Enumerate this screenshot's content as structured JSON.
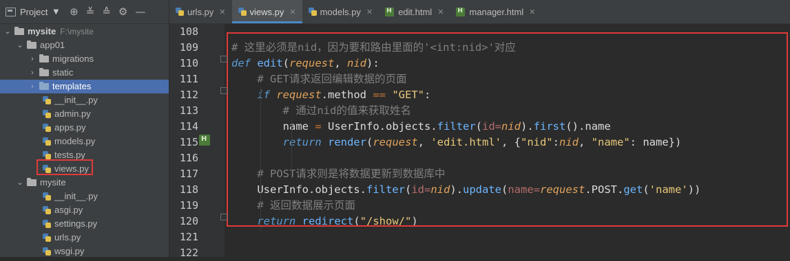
{
  "sidebar": {
    "toolbar": {
      "project_label": "Project"
    },
    "tree": [
      {
        "label": "mysite",
        "path": "F:\\mysite",
        "type": "folder-root",
        "expanded": true,
        "indent": 0
      },
      {
        "label": "app01",
        "type": "folder",
        "expanded": true,
        "indent": 1
      },
      {
        "label": "migrations",
        "type": "folder",
        "expanded": false,
        "indent": 2
      },
      {
        "label": "static",
        "type": "folder",
        "expanded": false,
        "indent": 2
      },
      {
        "label": "templates",
        "type": "folder",
        "expanded": false,
        "indent": 2,
        "selected": true
      },
      {
        "label": "__init__.py",
        "type": "py",
        "indent": 3
      },
      {
        "label": "admin.py",
        "type": "py",
        "indent": 3
      },
      {
        "label": "apps.py",
        "type": "py",
        "indent": 3
      },
      {
        "label": "models.py",
        "type": "py",
        "indent": 3
      },
      {
        "label": "tests.py",
        "type": "py",
        "indent": 3
      },
      {
        "label": "views.py",
        "type": "py",
        "indent": 3,
        "highlighted": true
      },
      {
        "label": "mysite",
        "type": "folder",
        "expanded": true,
        "indent": 1
      },
      {
        "label": "__init__.py",
        "type": "py",
        "indent": 3
      },
      {
        "label": "asgi.py",
        "type": "py",
        "indent": 3
      },
      {
        "label": "settings.py",
        "type": "py",
        "indent": 3
      },
      {
        "label": "urls.py",
        "type": "py",
        "indent": 3
      },
      {
        "label": "wsgi.py",
        "type": "py",
        "indent": 3
      }
    ]
  },
  "tabs": [
    {
      "label": "urls.py",
      "type": "py",
      "active": false
    },
    {
      "label": "views.py",
      "type": "py",
      "active": true
    },
    {
      "label": "models.py",
      "type": "py",
      "active": false
    },
    {
      "label": "edit.html",
      "type": "html",
      "active": false
    },
    {
      "label": "manager.html",
      "type": "html",
      "active": false
    }
  ],
  "editor": {
    "lines": [
      {
        "num": "108",
        "tokens": []
      },
      {
        "num": "109",
        "tokens": [
          [
            "cm",
            "# 这里必须是nid，因为要和路由里面的'<int:nid>'对应"
          ]
        ]
      },
      {
        "num": "110",
        "tokens": [
          [
            "kwi",
            "def "
          ],
          [
            "fn",
            "edit"
          ],
          [
            "tx",
            "("
          ],
          [
            "par",
            "request"
          ],
          [
            "tx",
            ", "
          ],
          [
            "par",
            "nid"
          ],
          [
            "tx",
            "):"
          ]
        ]
      },
      {
        "num": "111",
        "tokens": [
          [
            "tx",
            "    "
          ],
          [
            "cm",
            "# GET请求返回编辑数据的页面"
          ]
        ]
      },
      {
        "num": "112",
        "tokens": [
          [
            "tx",
            "    "
          ],
          [
            "kwi",
            "if "
          ],
          [
            "par",
            "request"
          ],
          [
            "tx",
            ".method "
          ],
          [
            "op",
            "=="
          ],
          [
            "tx",
            " "
          ],
          [
            "str",
            "\"GET\""
          ],
          [
            "tx",
            ":"
          ]
        ]
      },
      {
        "num": "113",
        "tokens": [
          [
            "tx",
            "        "
          ],
          [
            "cm",
            "# 通过nid的值来获取姓名"
          ]
        ]
      },
      {
        "num": "114",
        "tokens": [
          [
            "tx",
            "        name "
          ],
          [
            "op",
            "="
          ],
          [
            "tx",
            " UserInfo.objects."
          ],
          [
            "fn",
            "filter"
          ],
          [
            "tx",
            "("
          ],
          [
            "kwarg",
            "id="
          ],
          [
            "par",
            "nid"
          ],
          [
            "tx",
            ")."
          ],
          [
            "fn",
            "first"
          ],
          [
            "tx",
            "().name"
          ]
        ]
      },
      {
        "num": "115",
        "tokens": [
          [
            "tx",
            "        "
          ],
          [
            "kwi",
            "return "
          ],
          [
            "fn",
            "render"
          ],
          [
            "tx",
            "("
          ],
          [
            "par",
            "request"
          ],
          [
            "tx",
            ", "
          ],
          [
            "str",
            "'edit.html'"
          ],
          [
            "tx",
            ", {"
          ],
          [
            "str",
            "\"nid\""
          ],
          [
            "tx",
            ":"
          ],
          [
            "par",
            "nid"
          ],
          [
            "tx",
            ", "
          ],
          [
            "str",
            "\"name\""
          ],
          [
            "tx",
            ": name})"
          ]
        ]
      },
      {
        "num": "116",
        "tokens": []
      },
      {
        "num": "117",
        "tokens": [
          [
            "tx",
            "    "
          ],
          [
            "cm",
            "# POST请求则是将数据更新到数据库中"
          ]
        ]
      },
      {
        "num": "118",
        "tokens": [
          [
            "tx",
            "    UserInfo.objects."
          ],
          [
            "fn",
            "filter"
          ],
          [
            "tx",
            "("
          ],
          [
            "kwarg",
            "id="
          ],
          [
            "par",
            "nid"
          ],
          [
            "tx",
            ")."
          ],
          [
            "fn",
            "update"
          ],
          [
            "tx",
            "("
          ],
          [
            "kwarg",
            "name="
          ],
          [
            "par",
            "request"
          ],
          [
            "tx",
            ".POST."
          ],
          [
            "fn",
            "get"
          ],
          [
            "tx",
            "("
          ],
          [
            "str",
            "'name'"
          ],
          [
            "tx",
            "))"
          ]
        ]
      },
      {
        "num": "119",
        "tokens": [
          [
            "tx",
            "    "
          ],
          [
            "cm",
            "# 返回数据展示页面"
          ]
        ]
      },
      {
        "num": "120",
        "tokens": [
          [
            "tx",
            "    "
          ],
          [
            "kwi",
            "return "
          ],
          [
            "fn",
            "redirect"
          ],
          [
            "tx",
            "("
          ],
          [
            "str",
            "\"/show/\""
          ],
          [
            "tx",
            ")"
          ]
        ]
      },
      {
        "num": "121",
        "tokens": []
      },
      {
        "num": "122",
        "tokens": []
      }
    ]
  },
  "colors": {
    "annotation_box": "#e03b3b",
    "selection": "#4b6eaf"
  }
}
